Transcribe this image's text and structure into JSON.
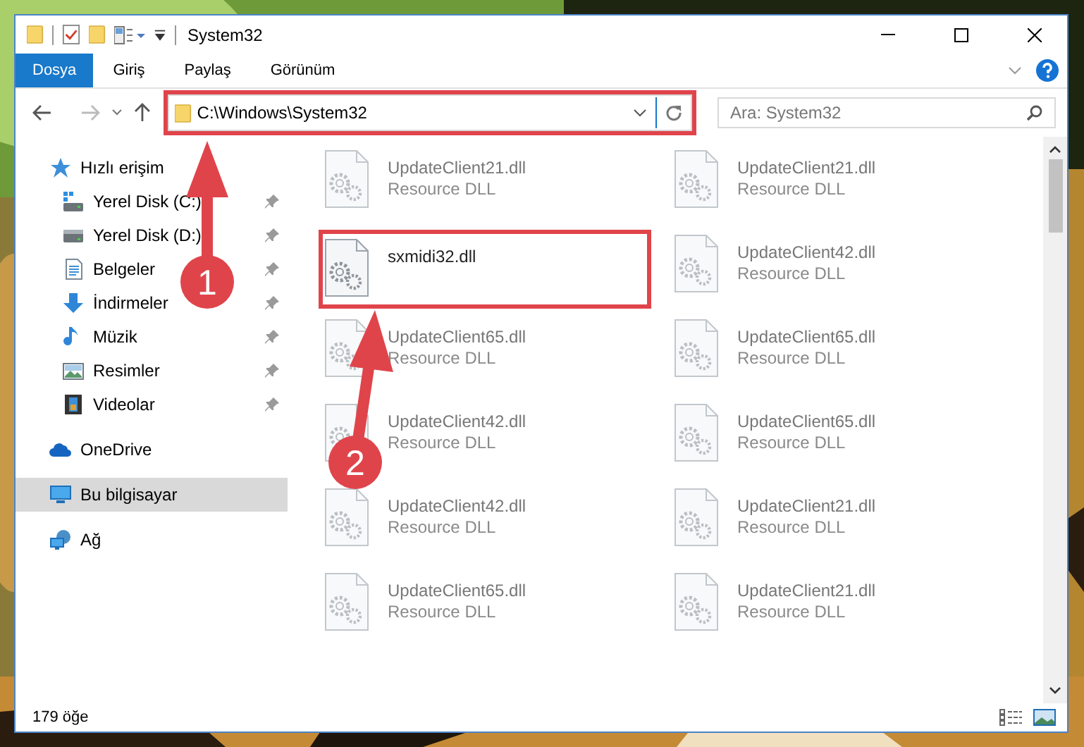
{
  "window": {
    "title": "System32"
  },
  "ribbon_tabs": [
    {
      "label": "Dosya",
      "selected": true
    },
    {
      "label": "Giriş",
      "selected": false
    },
    {
      "label": "Paylaş",
      "selected": false
    },
    {
      "label": "Görünüm",
      "selected": false
    }
  ],
  "address": {
    "path": "C:\\Windows\\System32",
    "highlighted": true
  },
  "search": {
    "placeholder": "Ara: System32"
  },
  "nav": [
    {
      "label": "Hızlı erişim",
      "kind": "star",
      "selected": false,
      "children": [
        {
          "label": "Yerel Disk (C:)",
          "kind": "drive-c",
          "pinned": true,
          "selected": false
        },
        {
          "label": "Yerel Disk (D:)",
          "kind": "drive",
          "pinned": true,
          "selected": false
        },
        {
          "label": "Belgeler",
          "kind": "documents",
          "pinned": true,
          "selected": false
        },
        {
          "label": "İndirmeler",
          "kind": "downloads",
          "pinned": true,
          "selected": false
        },
        {
          "label": "Müzik",
          "kind": "music",
          "pinned": true,
          "selected": false
        },
        {
          "label": "Resimler",
          "kind": "pictures",
          "pinned": true,
          "selected": false
        },
        {
          "label": "Videolar",
          "kind": "videos",
          "pinned": true,
          "selected": false
        }
      ]
    },
    {
      "label": "OneDrive",
      "kind": "cloud",
      "selected": false
    },
    {
      "label": "Bu bilgisayar",
      "kind": "pc",
      "selected": true
    },
    {
      "label": "Ağ",
      "kind": "network",
      "selected": false
    }
  ],
  "files": [
    {
      "name": "UpdateClient21.dll",
      "type": "Resource DLL",
      "blurred": true,
      "highlighted": false
    },
    {
      "name": "UpdateClient21.dll",
      "type": "Resource DLL",
      "blurred": true,
      "highlighted": false
    },
    {
      "name": "sxmidi32.dll",
      "blurred": false,
      "highlighted": true
    },
    {
      "name": "UpdateClient42.dll",
      "type": "Resource DLL",
      "blurred": true,
      "highlighted": false
    },
    {
      "name": "UpdateClient65.dll",
      "type": "Resource DLL",
      "blurred": true,
      "highlighted": false
    },
    {
      "name": "UpdateClient65.dll",
      "type": "Resource DLL",
      "blurred": true,
      "highlighted": false
    },
    {
      "name": "UpdateClient42.dll",
      "type": "Resource DLL",
      "blurred": true,
      "highlighted": false
    },
    {
      "name": "UpdateClient65.dll",
      "type": "Resource DLL",
      "blurred": true,
      "highlighted": false
    },
    {
      "name": "UpdateClient42.dll",
      "type": "Resource DLL",
      "blurred": true,
      "highlighted": false
    },
    {
      "name": "UpdateClient21.dll",
      "type": "Resource DLL",
      "blurred": true,
      "highlighted": false
    },
    {
      "name": "UpdateClient65.dll",
      "type": "Resource DLL",
      "blurred": true,
      "highlighted": false
    },
    {
      "name": "UpdateClient21.dll",
      "type": "Resource DLL",
      "blurred": true,
      "highlighted": false
    }
  ],
  "callouts": [
    {
      "label": "1"
    },
    {
      "label": "2"
    }
  ],
  "status_bar": {
    "count": "179 öğe"
  }
}
